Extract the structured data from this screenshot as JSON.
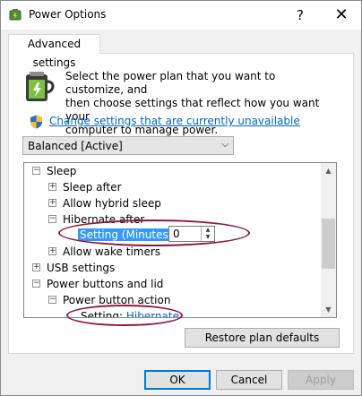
{
  "window": {
    "title": "Power Options",
    "help_glyph": "?",
    "close_glyph": "✕"
  },
  "tab": {
    "label": "Advanced settings"
  },
  "intro": {
    "line1": "Select the power plan that you want to customize, and",
    "line2": "then choose settings that reflect how you want your",
    "line3": "computer to manage power."
  },
  "change_link": "Change settings that are currently unavailable",
  "plan_select": {
    "value": "Balanced [Active]"
  },
  "tree": {
    "sleep": "Sleep",
    "sleep_after": "Sleep after",
    "hybrid_sleep": "Allow hybrid sleep",
    "hibernate_after": "Hibernate after",
    "minutes_label": "Setting (Minutes):",
    "minutes_value": "0",
    "wake_timers": "Allow wake timers",
    "usb": "USB settings",
    "power_buttons": "Power buttons and lid",
    "power_button_action": "Power button action",
    "setting_label": "Setting:",
    "setting_value": "Hibernate"
  },
  "expander": {
    "collapsed": "+",
    "expanded": "−"
  },
  "buttons": {
    "restore": "Restore plan defaults",
    "ok": "OK",
    "cancel": "Cancel",
    "apply": "Apply"
  },
  "colors": {
    "link": "#0066cc",
    "highlight": "#3399ff",
    "annotation": "#8b1a3c"
  }
}
